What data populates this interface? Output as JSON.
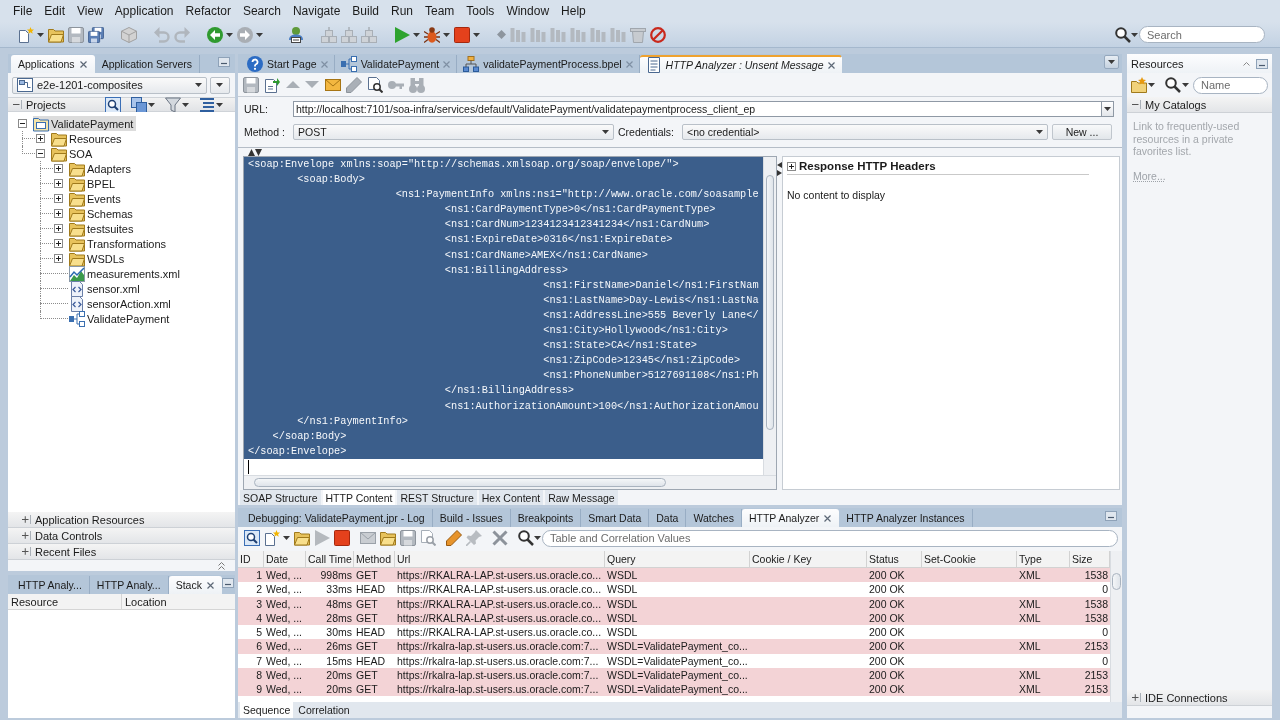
{
  "menu_bar": [
    "File",
    "Edit",
    "View",
    "Application",
    "Refactor",
    "Search",
    "Navigate",
    "Build",
    "Run",
    "Team",
    "Tools",
    "Window",
    "Help"
  ],
  "main_toolbar": {
    "groups": [
      [
        {
          "kind": "new",
          "disabled": false,
          "dropdown": true
        },
        {
          "kind": "open",
          "disabled": false,
          "dropdown": false
        },
        {
          "kind": "save",
          "disabled": true,
          "dropdown": false
        },
        {
          "kind": "save_all",
          "disabled": false,
          "dropdown": false
        }
      ],
      [
        {
          "kind": "cube",
          "disabled": true,
          "dropdown": false
        }
      ],
      [
        {
          "kind": "undo",
          "disabled": true,
          "dropdown": false
        },
        {
          "kind": "redo",
          "disabled": true,
          "dropdown": false
        }
      ],
      [
        {
          "kind": "back",
          "disabled": false,
          "dropdown": true
        },
        {
          "kind": "forward",
          "disabled": true,
          "dropdown": true
        }
      ],
      [
        {
          "kind": "user",
          "disabled": false,
          "dropdown": false
        }
      ],
      [
        {
          "kind": "build",
          "disabled": true,
          "dropdown": false
        },
        {
          "kind": "build",
          "disabled": true,
          "dropdown": false
        },
        {
          "kind": "build",
          "disabled": true,
          "dropdown": false
        }
      ],
      [
        {
          "kind": "run",
          "disabled": false,
          "dropdown": true
        },
        {
          "kind": "debug",
          "disabled": false,
          "dropdown": true
        },
        {
          "kind": "stop",
          "disabled": false,
          "dropdown": true
        }
      ],
      [
        {
          "kind": "step",
          "disabled": true,
          "dropdown": false
        },
        {
          "kind": "bars",
          "disabled": true,
          "dropdown": false
        },
        {
          "kind": "bars",
          "disabled": true,
          "dropdown": false
        },
        {
          "kind": "bars",
          "disabled": true,
          "dropdown": false
        },
        {
          "kind": "bars",
          "disabled": true,
          "dropdown": false
        },
        {
          "kind": "bars",
          "disabled": true,
          "dropdown": false
        },
        {
          "kind": "bars",
          "disabled": true,
          "dropdown": false
        },
        {
          "kind": "trash",
          "disabled": true,
          "dropdown": false
        },
        {
          "kind": "nosign",
          "disabled": false,
          "dropdown": false
        }
      ]
    ],
    "search": {
      "placeholder": "Search"
    }
  },
  "applications_panel": {
    "tabs": [
      {
        "label": "Applications",
        "selected": true
      },
      {
        "label": "Application Servers",
        "selected": false
      }
    ],
    "application": "e2e-1201-composites",
    "projects": {
      "label": "Projects",
      "expanded": true
    },
    "tree": [
      {
        "label": "ValidatePayment",
        "kind": "project",
        "expanded": true,
        "selected": true,
        "children": [
          {
            "label": "Resources",
            "kind": "folder",
            "expanded": false,
            "selected": false
          },
          {
            "label": "SOA",
            "kind": "folder",
            "expanded": true,
            "selected": false,
            "children": [
              {
                "label": "Adapters",
                "kind": "folder",
                "expanded": false,
                "selected": false
              },
              {
                "label": "BPEL",
                "kind": "folder",
                "expanded": false,
                "selected": false
              },
              {
                "label": "Events",
                "kind": "folder",
                "expanded": false,
                "selected": false
              },
              {
                "label": "Schemas",
                "kind": "folder",
                "expanded": false,
                "selected": false
              },
              {
                "label": "testsuites",
                "kind": "folder",
                "expanded": false,
                "selected": false
              },
              {
                "label": "Transformations",
                "kind": "folder",
                "expanded": false,
                "selected": false
              },
              {
                "label": "WSDLs",
                "kind": "folder",
                "expanded": false,
                "selected": false
              },
              {
                "label": "measurements.xml",
                "kind": "chart_file",
                "selected": false
              },
              {
                "label": "sensor.xml",
                "kind": "xml_file",
                "selected": false
              },
              {
                "label": "sensorAction.xml",
                "kind": "xml_file",
                "selected": false
              },
              {
                "label": "ValidatePayment",
                "kind": "composite",
                "selected": false
              }
            ]
          }
        ]
      }
    ],
    "accordion": [
      {
        "label": "Application Resources",
        "expanded": false
      },
      {
        "label": "Data Controls",
        "expanded": false
      },
      {
        "label": "Recent Files",
        "expanded": false
      }
    ]
  },
  "stack_panel": {
    "tabs": [
      {
        "label": "HTTP Analy...",
        "selected": false
      },
      {
        "label": "HTTP Analy...",
        "selected": false
      },
      {
        "label": "Stack",
        "selected": true
      }
    ],
    "columns": [
      "Resource",
      "Location"
    ]
  },
  "editor_tabs": [
    {
      "label": "Start Page",
      "kind": "start",
      "selected": false
    },
    {
      "label": "ValidatePayment",
      "kind": "composite",
      "selected": false
    },
    {
      "label": "validatePaymentProcess.bpel",
      "kind": "bpel",
      "selected": false
    },
    {
      "label": "HTTP Analyzer : Unsent Message",
      "kind": "analyzer",
      "selected": true
    }
  ],
  "analyzer": {
    "toolbar": [
      [
        {
          "kind": "save",
          "disabled": true,
          "dropdown": false
        },
        {
          "kind": "export",
          "disabled": false,
          "dropdown": false
        }
      ],
      [
        {
          "kind": "up",
          "disabled": true,
          "dropdown": false
        },
        {
          "kind": "down",
          "disabled": true,
          "dropdown": false
        }
      ],
      [
        {
          "kind": "mail",
          "disabled": false,
          "dropdown": false
        },
        {
          "kind": "erase",
          "disabled": true,
          "dropdown": false
        },
        {
          "kind": "find_doc",
          "disabled": false,
          "dropdown": false
        },
        {
          "kind": "key",
          "disabled": true,
          "dropdown": false
        },
        {
          "kind": "binoculars",
          "disabled": true,
          "dropdown": false
        }
      ]
    ],
    "url_label": "URL:",
    "url": "http://localhost:7101/soa-infra/services/default/ValidatePayment/validatepaymentprocess_client_ep",
    "method_label": "Method :",
    "method": "POST",
    "credentials_label": "Credentials:",
    "credentials": "<no credential>",
    "new_button": "New ...",
    "request_body": {
      "selected": true,
      "lines": [
        "<soap:Envelope xmlns:soap=\"http://schemas.xmlsoap.org/soap/envelope/\">",
        "\t<soap:Body>",
        "\t\t\t<ns1:PaymentInfo xmlns:ns1=\"http://www.oracle.com/soasample",
        "\t\t\t\t<ns1:CardPaymentType>0</ns1:CardPaymentType>",
        "\t\t\t\t<ns1:CardNum>1234123412341234</ns1:CardNum>",
        "\t\t\t\t<ns1:ExpireDate>0316</ns1:ExpireDate>",
        "\t\t\t\t<ns1:CardName>AMEX</ns1:CardName>",
        "\t\t\t\t<ns1:BillingAddress>",
        "\t\t\t\t\t\t<ns1:FirstName>Daniel</ns1:FirstNam",
        "\t\t\t\t\t\t<ns1:LastName>Day-Lewis</ns1:LastNa",
        "\t\t\t\t\t\t<ns1:AddressLine>555 Beverly Lane</",
        "\t\t\t\t\t\t<ns1:City>Hollywood</ns1:City>",
        "\t\t\t\t\t\t<ns1:State>CA</ns1:State>",
        "\t\t\t\t\t\t<ns1:ZipCode>12345</ns1:ZipCode>",
        "\t\t\t\t\t\t<ns1:PhoneNumber>5127691108</ns1:Ph",
        "\t\t\t\t</ns1:BillingAddress>",
        "\t\t\t\t<ns1:AuthorizationAmount>100</ns1:AuthorizationAmou",
        "\t</ns1:PaymentInfo>",
        "    </soap:Body>",
        "</soap:Envelope>"
      ]
    },
    "response_headers": {
      "title": "Response HTTP Headers",
      "expanded": false,
      "message": "No content to display"
    },
    "view_tabs": [
      {
        "label": "SOAP Structure",
        "selected": false
      },
      {
        "label": "HTTP Content",
        "selected": true
      },
      {
        "label": "REST Structure",
        "selected": false
      },
      {
        "label": "Hex Content",
        "selected": false
      },
      {
        "label": "Raw Message",
        "selected": false
      }
    ]
  },
  "log_panel": {
    "tabs": [
      {
        "label": "Debugging: ValidatePayment.jpr - Log",
        "selected": false
      },
      {
        "label": "Build - Issues",
        "selected": false
      },
      {
        "label": "Breakpoints",
        "selected": false
      },
      {
        "label": "Smart Data",
        "selected": false
      },
      {
        "label": "Data",
        "selected": false
      },
      {
        "label": "Watches",
        "selected": false
      },
      {
        "label": "HTTP Analyzer",
        "selected": true
      },
      {
        "label": "HTTP Analyzer Instances",
        "selected": false
      }
    ],
    "toolbar": [
      [
        {
          "kind": "find_box",
          "disabled": false,
          "dropdown": false
        },
        {
          "kind": "new",
          "disabled": false,
          "dropdown": true
        },
        {
          "kind": "open",
          "disabled": false,
          "dropdown": false
        },
        {
          "kind": "run",
          "disabled": true,
          "dropdown": false
        },
        {
          "kind": "stop",
          "disabled": false,
          "dropdown": false
        }
      ],
      [
        {
          "kind": "mail",
          "disabled": true,
          "dropdown": false
        },
        {
          "kind": "open",
          "disabled": false,
          "dropdown": false
        },
        {
          "kind": "save",
          "disabled": true,
          "dropdown": false
        },
        {
          "kind": "find_doc",
          "disabled": true,
          "dropdown": false
        }
      ],
      [
        {
          "kind": "erase",
          "disabled": false,
          "dropdown": false
        },
        {
          "kind": "pin",
          "disabled": true,
          "dropdown": false
        }
      ],
      [
        {
          "kind": "clear",
          "disabled": true,
          "dropdown": false
        }
      ]
    ],
    "filter": {
      "placeholder": "Table and Correlation Values"
    },
    "table": {
      "columns": [
        "ID",
        "Date",
        "Call Time",
        "Method",
        "Url",
        "Query",
        "Cookie / Key",
        "Status",
        "Set-Cookie",
        "Type",
        "Size"
      ],
      "rows": [
        {
          "id": "1",
          "date": "Wed, ...",
          "call_time": "998ms",
          "method": "GET",
          "url": "https://RKALRA-LAP.st-users.us.oracle.co...",
          "query": "WSDL",
          "status": "200 OK",
          "type": "XML",
          "size": "1538",
          "highlighted": true
        },
        {
          "id": "2",
          "date": "Wed, ...",
          "call_time": "33ms",
          "method": "HEAD",
          "url": "https://RKALRA-LAP.st-users.us.oracle.co...",
          "query": "WSDL",
          "status": "200 OK",
          "size": "0",
          "highlighted": false
        },
        {
          "id": "3",
          "date": "Wed, ...",
          "call_time": "48ms",
          "method": "GET",
          "url": "https://RKALRA-LAP.st-users.us.oracle.co...",
          "query": "WSDL",
          "status": "200 OK",
          "type": "XML",
          "size": "1538",
          "highlighted": true
        },
        {
          "id": "4",
          "date": "Wed, ...",
          "call_time": "28ms",
          "method": "GET",
          "url": "https://RKALRA-LAP.st-users.us.oracle.co...",
          "query": "WSDL",
          "status": "200 OK",
          "type": "XML",
          "size": "1538",
          "highlighted": true
        },
        {
          "id": "5",
          "date": "Wed, ...",
          "call_time": "30ms",
          "method": "HEAD",
          "url": "https://RKALRA-LAP.st-users.us.oracle.co...",
          "query": "WSDL",
          "status": "200 OK",
          "size": "0",
          "highlighted": false
        },
        {
          "id": "6",
          "date": "Wed, ...",
          "call_time": "26ms",
          "method": "GET",
          "url": "https://rkalra-lap.st-users.us.oracle.com:7...",
          "query": "WSDL=ValidatePayment_co...",
          "status": "200 OK",
          "type": "XML",
          "size": "2153",
          "highlighted": true
        },
        {
          "id": "7",
          "date": "Wed, ...",
          "call_time": "15ms",
          "method": "HEAD",
          "url": "https://rkalra-lap.st-users.us.oracle.com:7...",
          "query": "WSDL=ValidatePayment_co...",
          "status": "200 OK",
          "size": "0",
          "highlighted": false
        },
        {
          "id": "8",
          "date": "Wed, ...",
          "call_time": "20ms",
          "method": "GET",
          "url": "https://rkalra-lap.st-users.us.oracle.com:7...",
          "query": "WSDL=ValidatePayment_co...",
          "status": "200 OK",
          "type": "XML",
          "size": "2153",
          "highlighted": true
        },
        {
          "id": "9",
          "date": "Wed, ...",
          "call_time": "20ms",
          "method": "GET",
          "url": "https://rkalra-lap.st-users.us.oracle.com:7...",
          "query": "WSDL=ValidatePayment_co...",
          "status": "200 OK",
          "type": "XML",
          "size": "2153",
          "highlighted": true
        }
      ]
    },
    "bottom_tabs": [
      {
        "label": "Sequence",
        "selected": true
      },
      {
        "label": "Correlation",
        "selected": false
      }
    ]
  },
  "resources_panel": {
    "title": "Resources",
    "search": {
      "placeholder": "Name"
    },
    "catalogs": {
      "label": "My Catalogs",
      "expanded": true,
      "hint": "Link to frequently-used resources in a private favorites list.",
      "link": "More..."
    },
    "connections": {
      "label": "IDE Connections",
      "expanded": false
    }
  }
}
